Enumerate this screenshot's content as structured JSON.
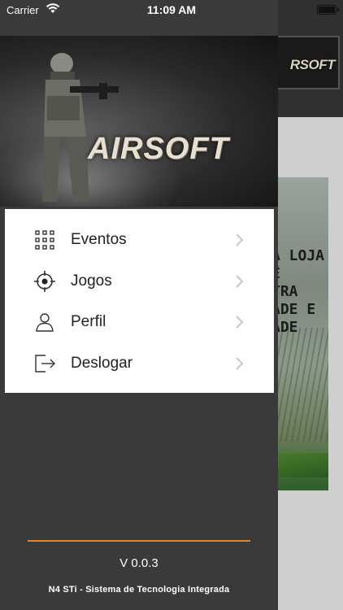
{
  "status_bar": {
    "carrier": "Carrier",
    "time": "11:09 AM"
  },
  "drawer": {
    "hero_title": "AIRSOFT",
    "menu": [
      {
        "label": "Eventos",
        "icon": "grid-icon"
      },
      {
        "label": "Jogos",
        "icon": "crosshair-icon"
      },
      {
        "label": "Perfil",
        "icon": "user-icon"
      },
      {
        "label": "Deslogar",
        "icon": "logout-icon"
      }
    ],
    "version": "V 0.0.3",
    "company": "N4 STi - Sistema de Tecnologia Integrada"
  },
  "main": {
    "header_banner_text": "RSOFT",
    "promo_text": "A LOJA\nÊ\nTRA\nADE E\nADE"
  },
  "colors": {
    "drawer_background": "#3a3a3a",
    "menu_background": "#ffffff",
    "divider_accent": "#e0892a",
    "chevron": "#c7c7cc"
  }
}
